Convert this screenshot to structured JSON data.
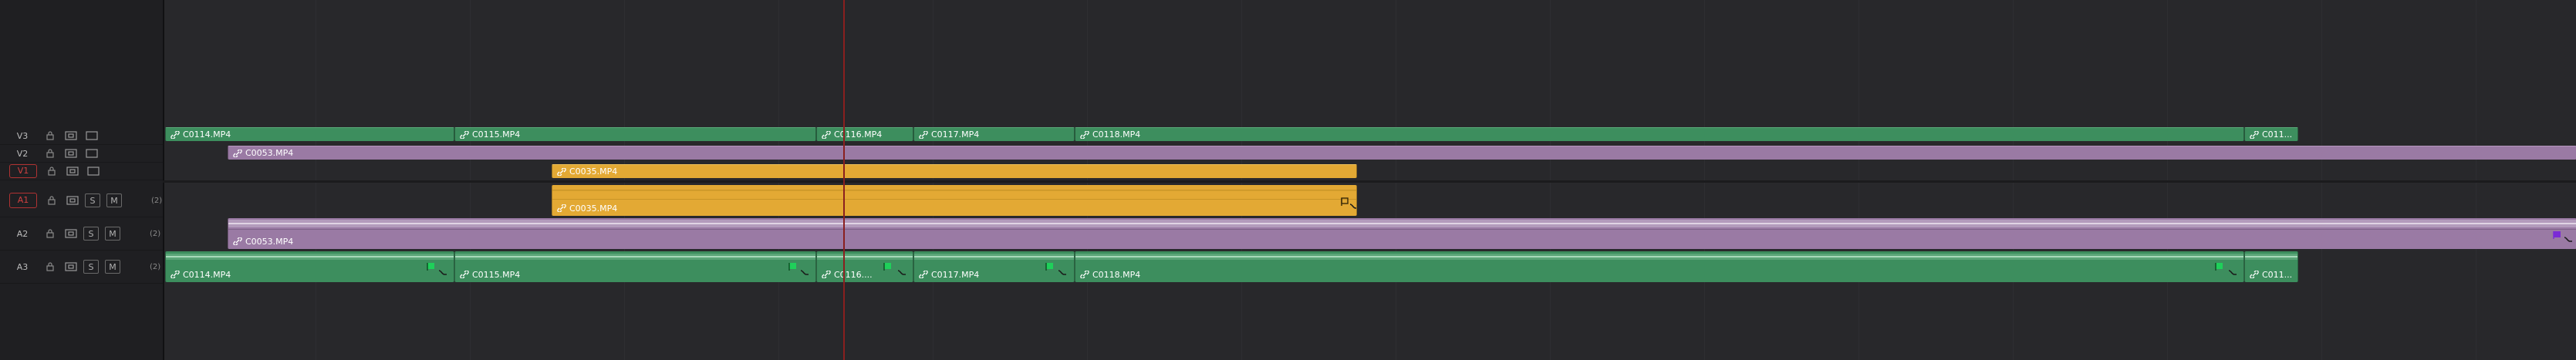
{
  "tracks": {
    "v3": {
      "name": "V3"
    },
    "v2": {
      "name": "V2"
    },
    "v1": {
      "name": "V1"
    },
    "a1": {
      "name": "A1",
      "solo": "S",
      "mute": "M",
      "channels": "(2)"
    },
    "a2": {
      "name": "A2",
      "solo": "S",
      "mute": "M",
      "channels": "(2)"
    },
    "a3": {
      "name": "A3",
      "solo": "S",
      "mute": "M",
      "channels": "(2)"
    }
  },
  "clips": {
    "v3": [
      {
        "label": "C0114.MP4"
      },
      {
        "label": "C0115.MP4"
      },
      {
        "label": "C0116.MP4"
      },
      {
        "label": "C0117.MP4"
      },
      {
        "label": "C0118.MP4"
      },
      {
        "label": "C011..."
      }
    ],
    "v2": [
      {
        "label": "C0053.MP4"
      }
    ],
    "v1": [
      {
        "label": "C0035.MP4"
      }
    ],
    "a1": [
      {
        "label": "C0035.MP4"
      }
    ],
    "a2": [
      {
        "label": "C0053.MP4"
      }
    ],
    "a3": [
      {
        "label": "C0114.MP4"
      },
      {
        "label": "C0115.MP4"
      },
      {
        "label": "C0116...."
      },
      {
        "label": "C0117.MP4"
      },
      {
        "label": "C0118.MP4"
      },
      {
        "label": "C011..."
      }
    ]
  },
  "colors": {
    "green_clip": "#3d8e5e",
    "purple_clip": "#9a7aa4",
    "yellow_clip": "#e3a934",
    "playhead": "#8a1f1f",
    "active_track": "#d04040"
  },
  "icons": {
    "lock": "lock-icon",
    "auto_select": "auto-select-icon",
    "monitor": "monitor-icon",
    "link": "link-icon",
    "flag": "flag-icon",
    "curve": "curve-icon"
  }
}
